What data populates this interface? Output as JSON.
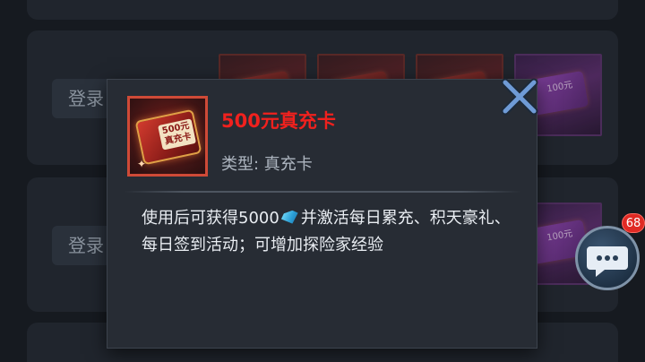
{
  "background": {
    "rows": [
      {
        "login_label": "登录"
      },
      {
        "login_label": "登录"
      }
    ],
    "card_texts": [
      "100元",
      "100元"
    ]
  },
  "popup": {
    "item": {
      "ticket_text": "500元真充卡",
      "title": "500元真充卡",
      "type_text": "类型: 真充卡",
      "icon": "red-recharge-card"
    },
    "description_before_icon": "使用后可获得5000",
    "currency_icon": "diamond-icon",
    "description_after_icon": "并激活每日累充、积天豪礼、每日签到活动；可增加探险家经验"
  },
  "close_icon": "close-x-icon",
  "chat": {
    "icon": "chat-bubble-icon",
    "badge_count": "68"
  },
  "colors": {
    "title_red": "#f0211e",
    "panel_bg": "#272c34",
    "close_blue": "#6f9bd6"
  }
}
